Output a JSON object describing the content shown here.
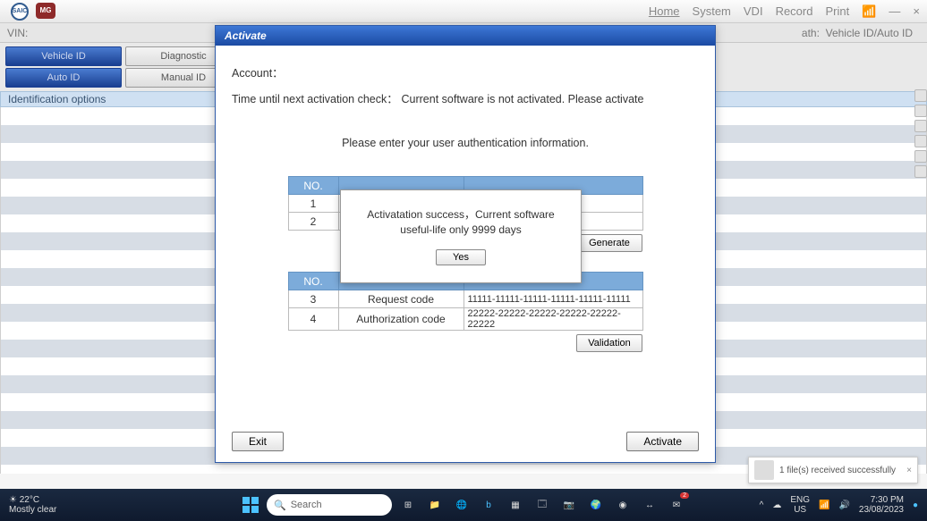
{
  "menubar": {
    "logo1": "SAIC",
    "logo2": "MG",
    "items": [
      "Home",
      "System",
      "VDI",
      "Record",
      "Print"
    ]
  },
  "vinbar": {
    "label": "VIN:",
    "path_label": "ath:",
    "path_value": "Vehicle ID/Auto ID"
  },
  "tabs": {
    "r1a": "Vehicle ID",
    "r1b": "Diagnostic",
    "r2a": "Auto ID",
    "r2b": "Manual ID"
  },
  "section_header": "Identification options",
  "modal": {
    "title": "Activate",
    "account_label": "Account：",
    "time_label": "Time until next activation check：",
    "time_value": "Current software is not activated. Please activate",
    "instr": "Please enter your user authentication information.",
    "tbl1_no": "NO.",
    "tbl1_r1_no": "1",
    "tbl1_r2_no": "2",
    "generate": "Generate",
    "tbl2_no": "NO.",
    "tbl2_r1_no": "3",
    "tbl2_r1_lab": "Request code",
    "tbl2_r1_val": "11111-11111-11111-11111-11111-11111",
    "tbl2_r2_no": "4",
    "tbl2_r2_lab": "Authorization code",
    "tbl2_r2_val": "22222-22222-22222-22222-22222-22222",
    "validation": "Validation",
    "exit": "Exit",
    "activate": "Activate"
  },
  "alert": {
    "msg": "Activatation success，Current software useful-life only 9999 days",
    "yes": "Yes"
  },
  "toast": {
    "msg": "1 file(s) received successfully"
  },
  "taskbar": {
    "temp": "22°C",
    "cond": "Mostly clear",
    "search_ph": "Search",
    "lang1": "ENG",
    "lang2": "US",
    "time": "7:30 PM",
    "date": "23/08/2023",
    "mail_badge": "2"
  }
}
